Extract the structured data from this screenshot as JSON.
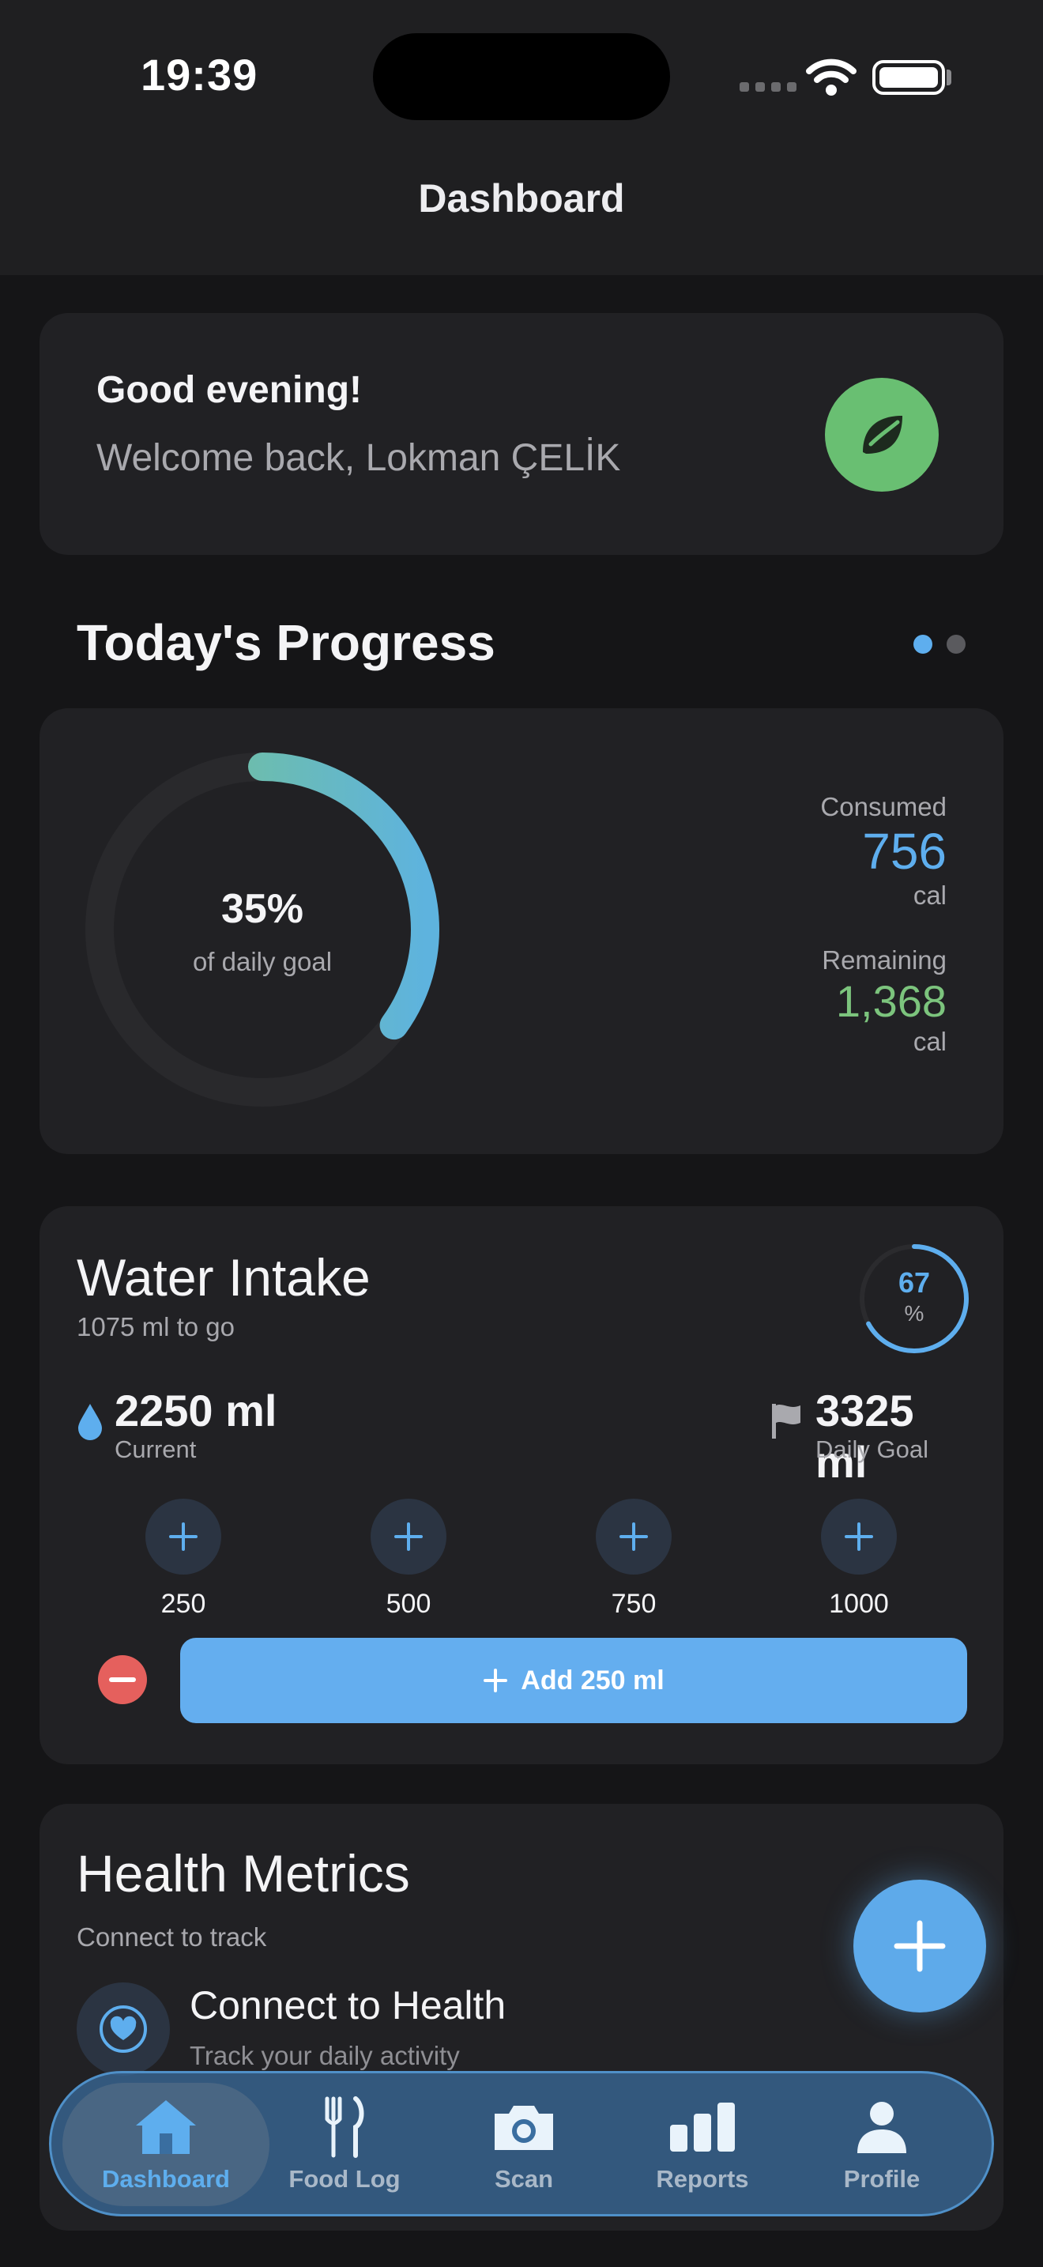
{
  "status_bar": {
    "time": "19:39"
  },
  "nav": {
    "title": "Dashboard"
  },
  "greeting": {
    "title": "Good evening!",
    "subtitle": "Welcome back, Lokman ÇELİK"
  },
  "progress": {
    "section_title": "Today's Progress",
    "percent_label": "35%",
    "percent_value": 0.35,
    "percent_sub": "of daily goal",
    "consumed_label": "Consumed",
    "consumed_value": "756",
    "consumed_unit": "cal",
    "remaining_label": "Remaining",
    "remaining_value": "1,368",
    "remaining_unit": "cal",
    "pager_active": 0,
    "pager_count": 2
  },
  "water": {
    "title": "Water Intake",
    "subtitle": "1075 ml to go",
    "percent_value": "67",
    "percent_fraction": 0.67,
    "percent_unit": "%",
    "current_value": "2250 ml",
    "current_label": "Current",
    "goal_value": "3325 ml",
    "goal_label": "Daily Goal",
    "quick_add": [
      "250",
      "500",
      "750",
      "1000"
    ],
    "add_button_label": "Add 250 ml"
  },
  "health": {
    "title": "Health Metrics",
    "subtitle": "Connect to track",
    "connect_label": "Connect to Health",
    "connect_sub": "Track your daily activity"
  },
  "tabbar": {
    "tabs": [
      {
        "label": "Dashboard",
        "icon": "house-icon",
        "active": true
      },
      {
        "label": "Food Log",
        "icon": "fork-knife-icon",
        "active": false
      },
      {
        "label": "Scan",
        "icon": "camera-icon",
        "active": false
      },
      {
        "label": "Reports",
        "icon": "bar-chart-icon",
        "active": false
      },
      {
        "label": "Profile",
        "icon": "person-icon",
        "active": false
      }
    ]
  },
  "colors": {
    "accent_blue": "#5eaeee",
    "accent_green": "#7cc47d",
    "danger_red": "#e5605d",
    "card_bg": "#212124",
    "page_bg": "#151517"
  }
}
